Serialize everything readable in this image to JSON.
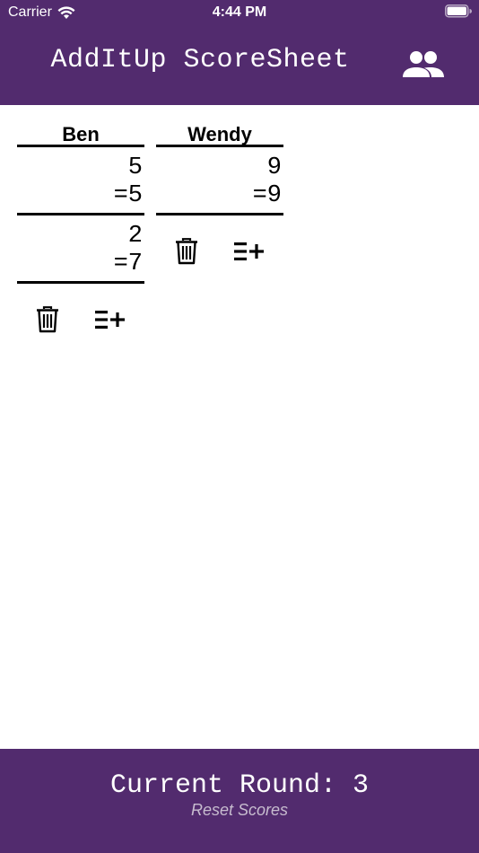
{
  "status_bar": {
    "carrier": "Carrier",
    "time": "4:44 PM"
  },
  "header": {
    "title": "AddItUp ScoreSheet",
    "players_icon": "players-icon"
  },
  "players": [
    {
      "name": "Ben",
      "rounds": [
        {
          "score": "5",
          "total": "=5"
        },
        {
          "score": "2",
          "total": "=7"
        }
      ]
    },
    {
      "name": "Wendy",
      "rounds": [
        {
          "score": "9",
          "total": "=9"
        }
      ]
    }
  ],
  "actions": {
    "delete_icon": "trash-icon",
    "add_icon": "add-round-icon"
  },
  "footer": {
    "current_round": "Current Round: 3",
    "reset_label": "Reset Scores"
  },
  "colors": {
    "brand": "#522b6e",
    "text_on_brand": "#ffffff",
    "reset_link": "#c7bccf"
  }
}
